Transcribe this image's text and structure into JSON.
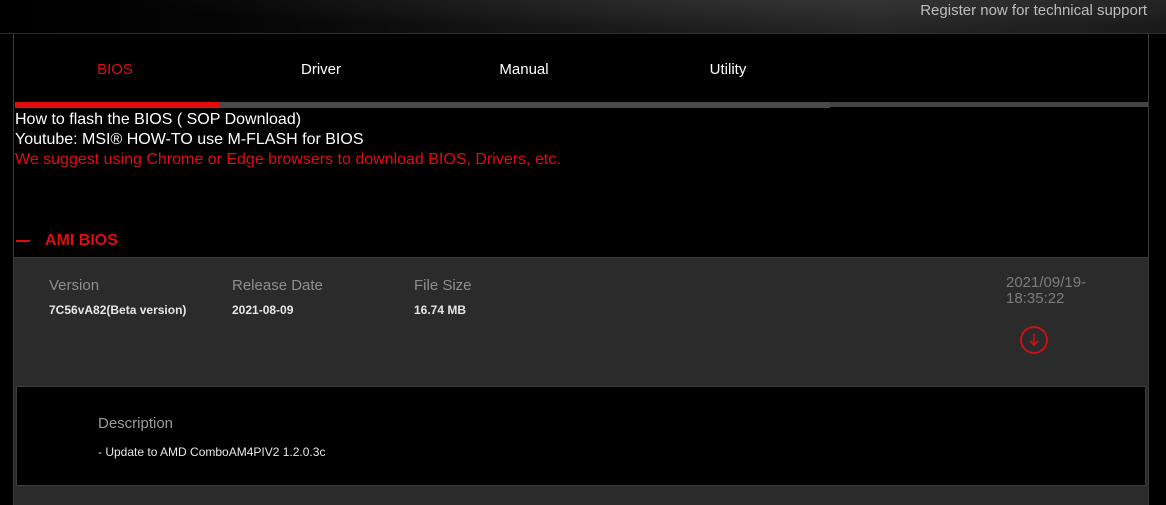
{
  "header": {
    "register_link": "Register now for technical support"
  },
  "tabs": [
    {
      "label": "BIOS",
      "active": true
    },
    {
      "label": "Driver",
      "active": false
    },
    {
      "label": "Manual",
      "active": false
    },
    {
      "label": "Utility",
      "active": false
    }
  ],
  "intro": {
    "flash_link": "How to flash the BIOS ( SOP Download)",
    "youtube_link": "Youtube: MSI® HOW-TO use M-FLASH for BIOS",
    "browser_note": "We suggest using Chrome or Edge browsers to download BIOS, Drivers, etc."
  },
  "section": {
    "title": "AMI BIOS"
  },
  "bios_entry": {
    "version_label": "Version",
    "version_value": "7C56vA82(Beta version)",
    "release_label": "Release Date",
    "release_value": "2021-08-09",
    "size_label": "File Size",
    "size_value": "16.74 MB",
    "timestamp": "2021/09/19-18:35:22",
    "download_icon": "download-arrow-icon"
  },
  "description": {
    "label": "Description",
    "text": "- Update to AMD ComboAM4PIV2 1.2.0.3c"
  },
  "colors": {
    "accent": "#e10d0d",
    "card_bg": "#2b2b2b",
    "page_bg": "#000000"
  }
}
